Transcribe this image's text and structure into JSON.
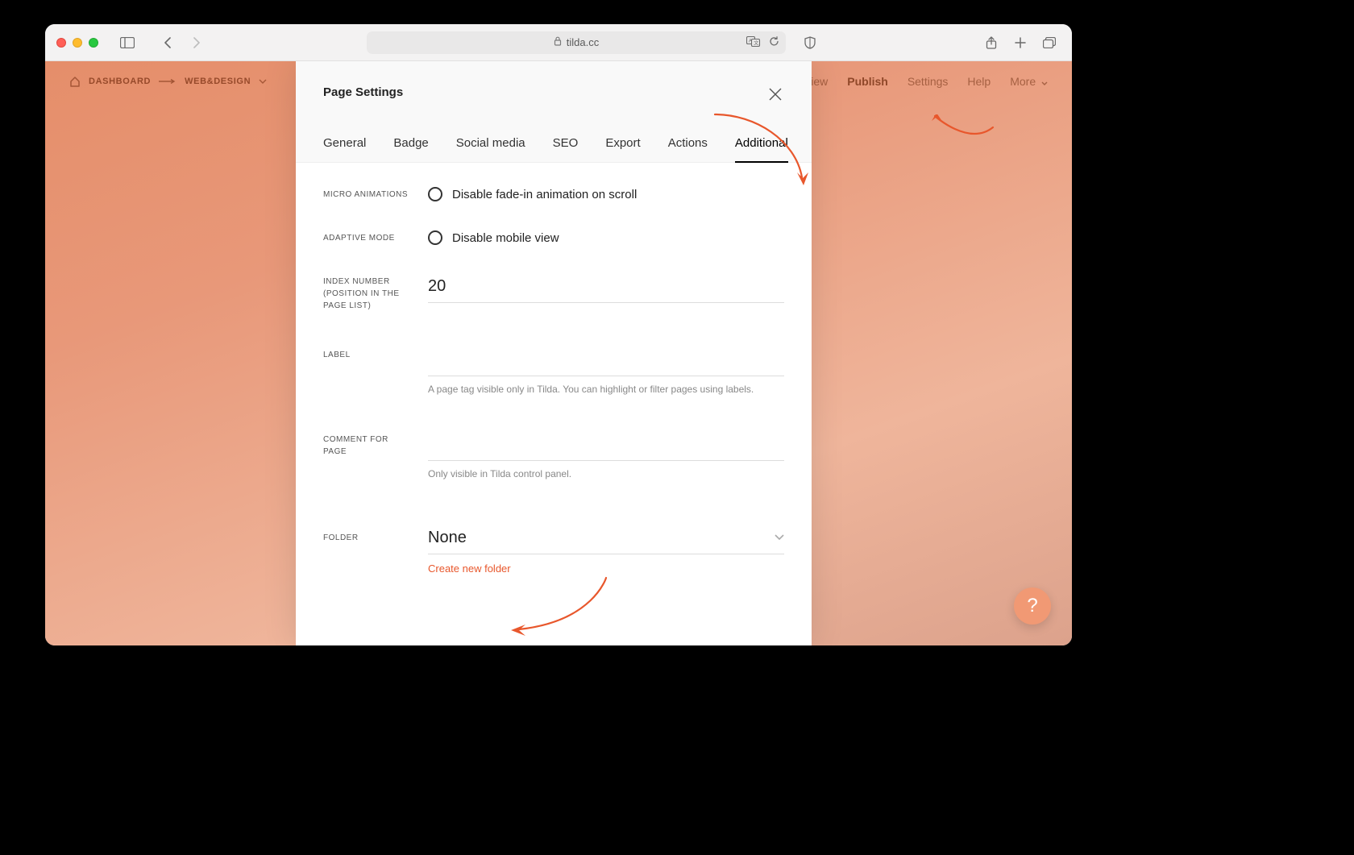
{
  "browser": {
    "url_host": "tilda.cc"
  },
  "topnav": {
    "dashboard": "DASHBOARD",
    "project": "WEB&DESIGN",
    "right": {
      "preview": "view",
      "publish": "Publish",
      "settings": "Settings",
      "help": "Help",
      "more": "More"
    }
  },
  "modal": {
    "title": "Page Settings",
    "tabs": {
      "general": "General",
      "badge": "Badge",
      "social": "Social media",
      "seo": "SEO",
      "export": "Export",
      "actions": "Actions",
      "additional": "Additional"
    },
    "fields": {
      "microanim_label": "MICRO ANIMATIONS",
      "microanim_option": "Disable fade-in animation on scroll",
      "adaptive_label": "ADAPTIVE MODE",
      "adaptive_option": "Disable mobile view",
      "index_label": "INDEX NUMBER (POSITION IN THE PAGE LIST)",
      "index_value": "20",
      "label_label": "LABEL",
      "label_value": "",
      "label_helper": "A page tag visible only in Tilda. You can highlight or filter pages using labels.",
      "comment_label": "COMMENT FOR PAGE",
      "comment_value": "",
      "comment_helper": "Only visible in Tilda control panel.",
      "folder_label": "FOLDER",
      "folder_value": "None",
      "folder_create": "Create new folder"
    }
  },
  "help_fab": "?"
}
